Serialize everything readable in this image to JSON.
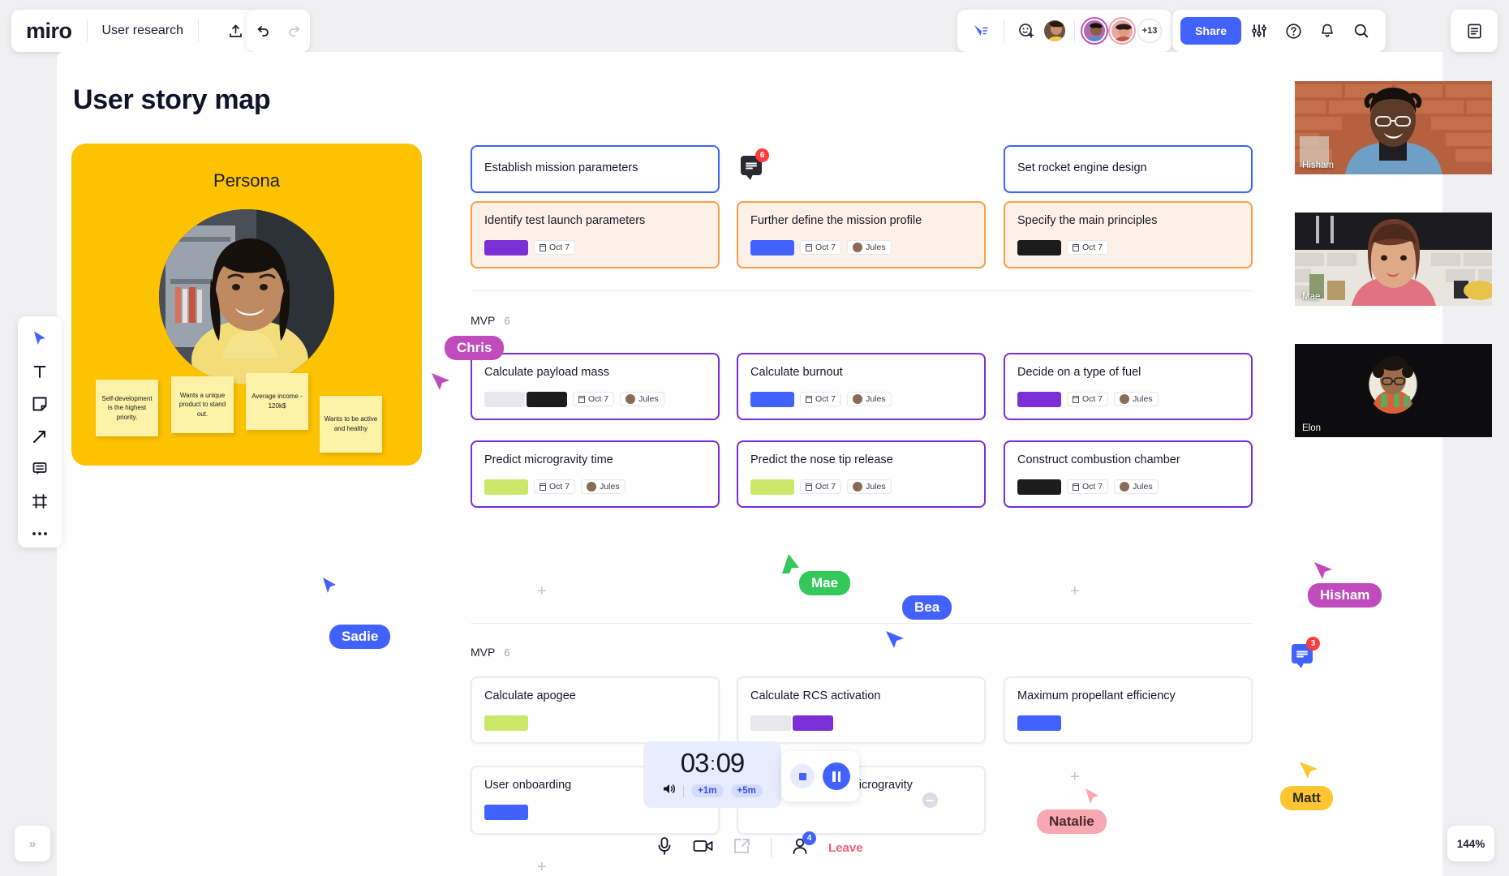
{
  "topbar": {
    "logo": "miro",
    "board_title": "User research",
    "share_label": "Share",
    "collab_overflow": "+13",
    "icons": {
      "upload": "upload-icon",
      "undo": "undo-icon",
      "redo": "redo-icon",
      "pointer": "follow-pointer-icon",
      "reaction": "add-reaction-icon",
      "settings": "sliders-icon",
      "help": "help-circle-icon",
      "notifications": "bell-icon",
      "search": "search-icon",
      "panel": "panel-icon"
    }
  },
  "canvas": {
    "page_title": "User story map"
  },
  "persona": {
    "heading": "Persona",
    "stickies": [
      "Self-development is the highest priority.",
      "Wants a unique product to stand out.",
      "Average income - 120k$",
      "Wants to be active and healthy"
    ]
  },
  "sections": [
    {
      "label": "MVP",
      "count": "6"
    },
    {
      "label": "MVP",
      "count": "6"
    }
  ],
  "epics": [
    {
      "title": "Establish mission parameters"
    },
    {
      "title": "Set rocket engine design"
    }
  ],
  "row_orange": [
    {
      "title": "Identify test launch parameters",
      "swatch": "#7b2fd4",
      "date": "Oct 7",
      "assignee": null
    },
    {
      "title": "Further define the mission profile",
      "swatch": "#4262ff",
      "date": "Oct 7",
      "assignee": "Jules"
    },
    {
      "title": "Specify the main principles",
      "swatch": "#1c1c1c",
      "date": "Oct 7",
      "assignee": null
    }
  ],
  "row_mvp1": [
    {
      "title": "Calculate payload mass",
      "swatch": "#e8e8ec",
      "swatch2": "#1c1c1c",
      "date": "Oct 7",
      "assignee": "Jules"
    },
    {
      "title": "Calculate burnout",
      "swatch": "#4262ff",
      "date": "Oct 7",
      "assignee": "Jules"
    },
    {
      "title": "Decide on a type of fuel",
      "swatch": "#7b2fd4",
      "date": "Oct 7",
      "assignee": "Jules"
    }
  ],
  "row_mvp2": [
    {
      "title": "Predict microgravity time",
      "swatch": "#cbe86b",
      "date": "Oct 7",
      "assignee": "Jules"
    },
    {
      "title": "Predict the nose tip release",
      "swatch": "#cbe86b",
      "date": "Oct 7",
      "assignee": "Jules"
    },
    {
      "title": "Construct combustion chamber",
      "swatch": "#1c1c1c",
      "date": "Oct 7",
      "assignee": "Jules"
    }
  ],
  "row_mvp3": [
    {
      "title": "Calculate apogee",
      "swatch": "#cbe86b"
    },
    {
      "title": "Calculate RCS activation",
      "swatch": "#e8e8ec",
      "swatch2": "#7b2fd4"
    },
    {
      "title": "Maximum propellant efficiency",
      "swatch": "#4262ff"
    }
  ],
  "row_mvp4": [
    {
      "title": "User onboarding",
      "swatch": "#4262ff"
    },
    {
      "title": "Predict the start of microgravity"
    }
  ],
  "comment_pins": [
    {
      "count": "6",
      "color": "#2a2a33"
    },
    {
      "count": "3",
      "color": "#4262ff"
    }
  ],
  "cursors": [
    {
      "name": "Chris",
      "color": "#c04bbd"
    },
    {
      "name": "Sadie",
      "color": "#4262ff"
    },
    {
      "name": "Mae",
      "color": "#34c759"
    },
    {
      "name": "Bea",
      "color": "#4262ff"
    },
    {
      "name": "Hisham",
      "color": "#c04bbd"
    },
    {
      "name": "Matt",
      "color": "#ffc631"
    },
    {
      "name": "Natalie",
      "color": "#f7a8b0"
    }
  ],
  "video_tiles": [
    {
      "name": "Hisham"
    },
    {
      "name": "Mae"
    },
    {
      "name": "Elon"
    }
  ],
  "timer": {
    "minutes": "03",
    "seconds": "09",
    "separator": ":",
    "add1": "+1m",
    "add5": "+5m"
  },
  "callbar": {
    "leave_label": "Leave",
    "participants": "4",
    "icons": {
      "mic": "microphone-icon",
      "camera": "camera-icon",
      "share_screen": "share-screen-icon",
      "people": "people-icon"
    }
  },
  "left_toolbar": [
    {
      "icon": "cursor-icon",
      "name": "select-tool",
      "active": true
    },
    {
      "icon": "text-icon",
      "name": "text-tool"
    },
    {
      "icon": "sticky-note-icon",
      "name": "sticky-note-tool"
    },
    {
      "icon": "arrow-icon",
      "name": "arrow-tool"
    },
    {
      "icon": "comment-icon",
      "name": "comment-tool"
    },
    {
      "icon": "frame-icon",
      "name": "frame-tool"
    },
    {
      "icon": "more-icon",
      "name": "more-tools"
    }
  ],
  "footer": {
    "collapse": "»",
    "zoom": "144%"
  }
}
